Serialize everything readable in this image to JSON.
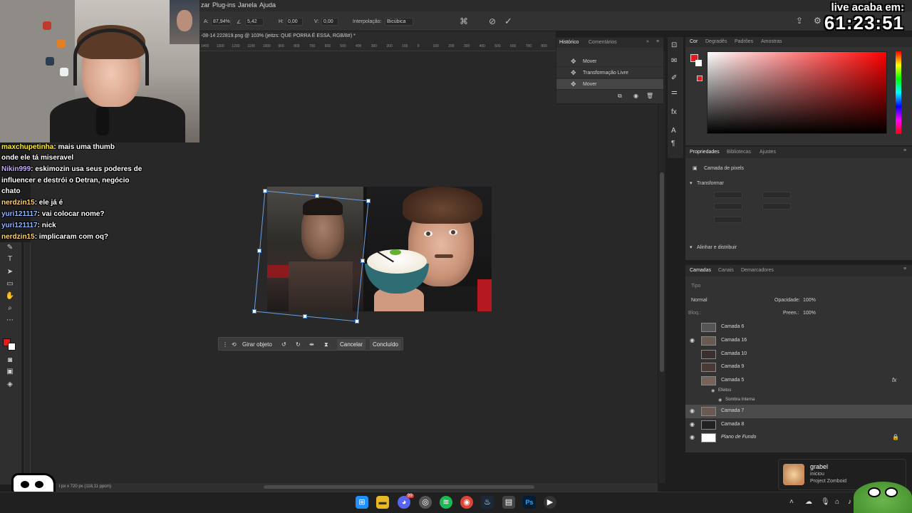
{
  "menubar": {
    "items": [
      "zar",
      "Plug-ins",
      "Janela",
      "Ajuda"
    ]
  },
  "options_bar": {
    "a_label": "A:",
    "a_value": "87,94%",
    "angle_value": "5,42",
    "h_label": "H:",
    "h_value": "0,00",
    "v_label": "V:",
    "v_value": "0,00",
    "interp_label": "Interpolação:",
    "interp_value": "Bicúbica"
  },
  "document": {
    "tab_title": "-08-14 222819.png @ 103% (jeitzs: QUE PORRA É ESSA, RGB/8#) *",
    "ruler_ticks": [
      "1400",
      "1300",
      "1200",
      "1100",
      "1000",
      "900",
      "800",
      "700",
      "600",
      "500",
      "400",
      "300",
      "200",
      "100",
      "0",
      "100",
      "200",
      "300",
      "400",
      "500",
      "600",
      "700",
      "800"
    ],
    "status": "l px x 720 px (118,11 ppcm)"
  },
  "transform_bar": {
    "rotate_label": "Girar objeto",
    "cancel_label": "Cancelar",
    "done_label": "Concluído"
  },
  "history": {
    "tabs": [
      "Histórico",
      "Comentários"
    ],
    "items": [
      "Mover",
      "Transformação Livre",
      "Mover"
    ]
  },
  "color_panel": {
    "tabs": [
      "Cor",
      "Degradês",
      "Padrões",
      "Amostras"
    ],
    "foreground": "#e51a1a",
    "background": "#ffffff"
  },
  "properties": {
    "tabs": [
      "Propriedades",
      "Bibliotecas",
      "Ajustes"
    ],
    "layer_type": "Camada de pixels",
    "transform_label": "Transformar",
    "align_label": "Alinhar e distribuir"
  },
  "layers": {
    "tabs": [
      "Camadas",
      "Canais",
      "Demarcadores"
    ],
    "search_placeholder": "Tipo",
    "blend_mode": "Normal",
    "opacity_label": "Opacidade:",
    "opacity_value": "100%",
    "fill_label": "Preen.:",
    "fill_value": "100%",
    "lock_label": "Bloq.:",
    "items": [
      {
        "name": "Camada 6",
        "visible": false
      },
      {
        "name": "Camada 16",
        "visible": true
      },
      {
        "name": "Camada 10",
        "visible": false
      },
      {
        "name": "Camada 9",
        "visible": false
      },
      {
        "name": "Camada 5",
        "visible": false
      },
      {
        "name": "Camada 7",
        "visible": true
      },
      {
        "name": "Camada 8",
        "visible": true
      },
      {
        "name": "Plano de Fundo",
        "visible": true
      }
    ],
    "effects_label": "Efeitos",
    "effect_name": "Sombra Interna"
  },
  "chat": {
    "messages": [
      {
        "user": "maxchupetinha",
        "text": "mais uma thumb"
      },
      {
        "user": "",
        "text": "onde ele tá miseravel"
      },
      {
        "user": "Nikin999",
        "text": "eskimozin usa seus poderes de"
      },
      {
        "user": "",
        "text": "influencer e destrói o Detran, negócio"
      },
      {
        "user": "",
        "text": "chato"
      },
      {
        "user": "nerdzin15",
        "text": "ele já é"
      },
      {
        "user": "yuri121117",
        "text": "vai colocar nome?"
      },
      {
        "user": "yuri121117",
        "text": "nick"
      },
      {
        "user": "nerdzin15",
        "text": "implicaram com oq?"
      }
    ]
  },
  "live_timer": {
    "label": "live acaba em:",
    "value": "61:23:51"
  },
  "notification": {
    "name": "grabel",
    "status": "iniciou",
    "game": "Project Zomboid"
  },
  "taskbar": {
    "icons": [
      "windows-icon",
      "file-explorer-icon",
      "discord-icon",
      "chrome-canary-icon",
      "spotify-icon",
      "chrome-icon",
      "steam-icon",
      "app-icon",
      "photoshop-icon",
      "media-icon"
    ],
    "discord_badge": "99"
  }
}
